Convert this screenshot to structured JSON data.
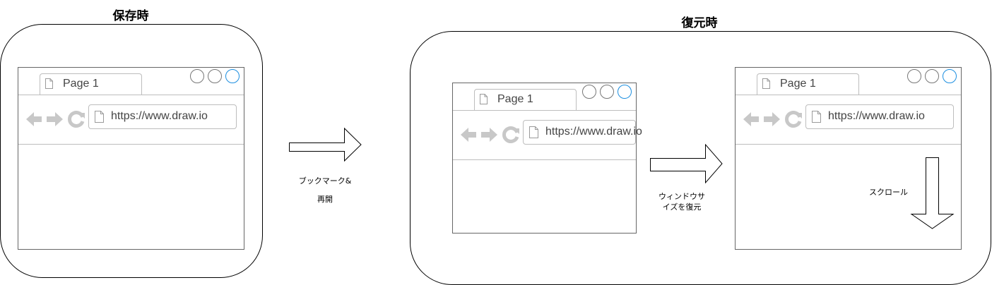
{
  "save_section": {
    "title": "保存時"
  },
  "restore_section": {
    "title": "復元時"
  },
  "browsers": [
    {
      "tab_label": "Page 1",
      "url": "https://www.draw.io"
    },
    {
      "tab_label": "Page 1",
      "url": "https://www.draw.io"
    },
    {
      "tab_label": "Page 1",
      "url": "https://www.draw.io"
    }
  ],
  "arrows": {
    "bookmark_label_line1": "ブックマーク&",
    "bookmark_label_line2": "再開",
    "resize_label_line1": "ウィンドウサ",
    "resize_label_line2": "イズを復元",
    "scroll_label": "スクロール"
  },
  "icons": {
    "back": "back-arrow-icon",
    "forward": "forward-arrow-icon",
    "reload": "reload-icon",
    "page": "page-icon"
  },
  "colors": {
    "active_window_button": "#1d8fe0",
    "chrome_border": "#bdbdbd",
    "nav_icons": "#c8c8c8"
  }
}
